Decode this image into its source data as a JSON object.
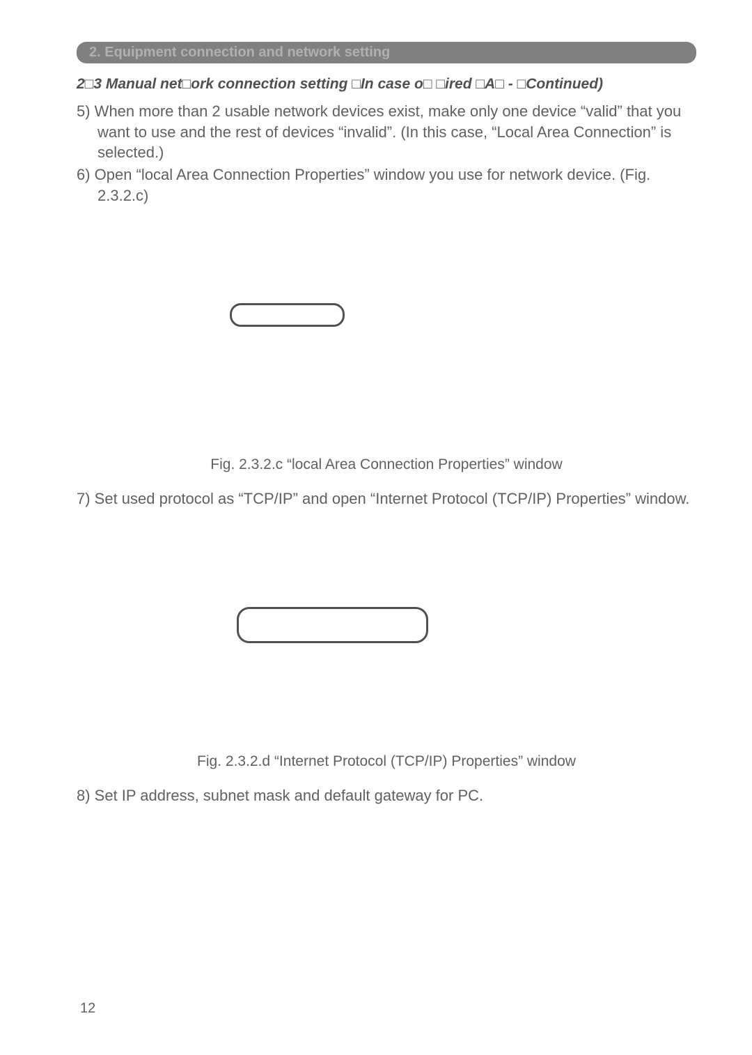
{
  "section_header": "2. Equipment connection and network setting",
  "subsection_title": "2□3 Manual net□ork connection setting □In case o□  □ired □A□ - □Continued)",
  "step5": "5) When more than 2 usable network devices exist, make only one device “valid” that you want to use and the rest of devices “invalid”. (In this case, “Local Area Connection” is selected.)",
  "step6": "6) Open “local Area Connection Properties” window you use for network device. (Fig. 2.3.2.c)",
  "caption1": "Fig. 2.3.2.c “local Area Connection Properties” window",
  "step7": "7) Set used protocol as “TCP/IP” and open “Internet Protocol (TCP/IP) Properties” window.",
  "caption2": "Fig. 2.3.2.d “Internet Protocol (TCP/IP) Properties” window",
  "step8": "8) Set IP address, subnet mask and default gateway for PC.",
  "page_number": "12"
}
